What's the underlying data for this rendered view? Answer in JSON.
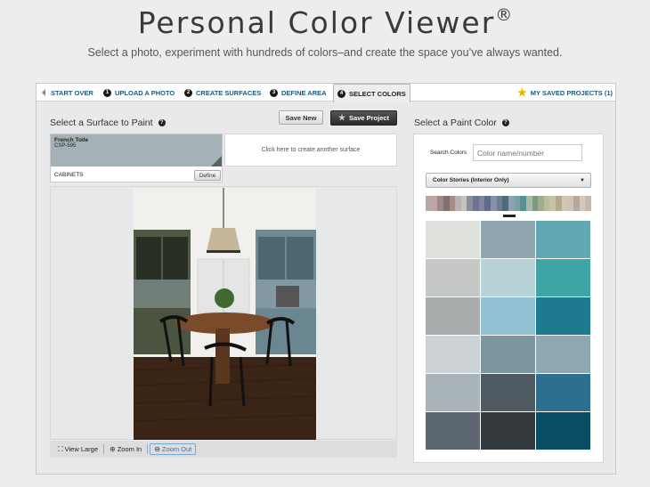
{
  "header": {
    "title": "Personal Color Viewer",
    "trademark": "®",
    "subtitle": "Select a photo, experiment with hundreds of colors–and create the space you’ve always wanted."
  },
  "nav": {
    "start_over": "START OVER",
    "steps": [
      {
        "num": "1",
        "label": "UPLOAD A PHOTO"
      },
      {
        "num": "2",
        "label": "CREATE SURFACES"
      },
      {
        "num": "3",
        "label": "DEFINE AREA"
      },
      {
        "num": "4",
        "label": "SELECT COLORS"
      }
    ],
    "saved_projects": "MY SAVED PROJECTS (1)"
  },
  "left_panel": {
    "title": "Select a Surface to Paint",
    "save_new": "Save New",
    "save_project": "Save Project",
    "surface": {
      "color_name": "French Toile",
      "color_code": "CSP-595",
      "color_hex": "#a4b1b7",
      "label": "CABINETS",
      "define": "Define"
    },
    "new_surface_prompt": "Click here to create another surface"
  },
  "toolbar": {
    "view_large": "View Large",
    "zoom_in": "Zoom In",
    "zoom_out": "Zoom Out"
  },
  "right_panel": {
    "title": "Select a Paint Color",
    "search_label": "Search Colors",
    "search_placeholder": "Color name/number",
    "stories_selected": "Color Stories (Interior Only)",
    "spectrum_colors": [
      "#b9a9a6",
      "#c3a49f",
      "#9d8a88",
      "#7e7170",
      "#a58d87",
      "#b9b2b0",
      "#c9c3bf",
      "#8a8d9a",
      "#6c7590",
      "#7c86a0",
      "#5f6b8a",
      "#8890a4",
      "#6d7c8f",
      "#4f6a7c",
      "#8ca3ad",
      "#7aa0a8",
      "#5a8f8f",
      "#a9b9a7",
      "#7f9a83",
      "#9fae8f",
      "#bdbd9a",
      "#c9c2a4",
      "#b5a98d",
      "#d0c7b4",
      "#cfc3b3",
      "#b8a79a",
      "#d3c8bd",
      "#c9b8aa"
    ],
    "colors": [
      "#dee0dc",
      "#8fa6ae",
      "#62a8b4",
      "#c6c8c6",
      "#b8d3d8",
      "#3fa4a6",
      "#a8acad",
      "#93c1d4",
      "#1e7b8f",
      "#cdd2d5",
      "#7b969d",
      "#8ea8b2",
      "#a8b3ba",
      "#4f5a62",
      "#2e6e8f",
      "#5b6670",
      "#34393d",
      "#0b4d65"
    ]
  }
}
